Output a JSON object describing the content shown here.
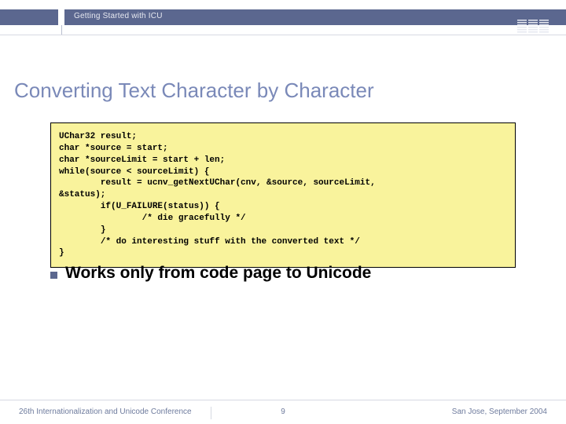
{
  "header": {
    "topbar_title": "Getting Started with ICU",
    "logo_name": "IBM"
  },
  "title": "Converting Text Character by Character",
  "code": "UChar32 result;\nchar *source = start;\nchar *sourceLimit = start + len;\nwhile(source < sourceLimit) {\n        result = ucnv_getNextUChar(cnv, &source, sourceLimit,\n&status);\n        if(U_FAILURE(status)) {\n                /* die gracefully */\n        }\n        /* do interesting stuff with the converted text */\n}",
  "bullet": {
    "text": "Works only from code page to Unicode"
  },
  "footer": {
    "left": "26th Internationalization and Unicode Conference",
    "page": "9",
    "right": "San Jose, September 2004"
  }
}
